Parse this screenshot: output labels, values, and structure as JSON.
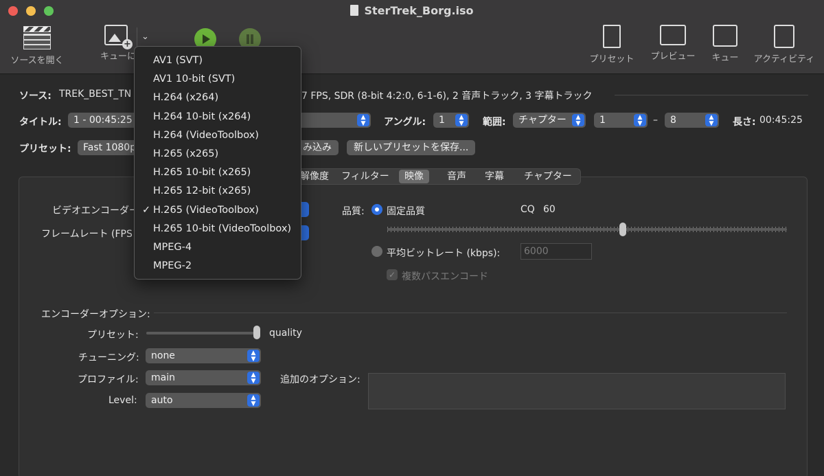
{
  "window": {
    "title": "SterTrek_Borg.iso"
  },
  "toolbar": {
    "open_source": "ソースを開く",
    "add_queue": "キューに",
    "presets": "プリセット",
    "preview": "プレビュー",
    "queue": "キュー",
    "activity": "アクティビティ"
  },
  "source": {
    "label": "ソース:",
    "name": "TREK_BEST_TN",
    "info": "7 FPS, SDR (8-bit 4:2:0, 6-1-6), 2 音声トラック, 3 字幕トラック"
  },
  "title_row": {
    "label": "タイトル:",
    "value": "1 - 00:45:25",
    "angle_label": "アングル:",
    "angle": "1",
    "range_label": "範囲:",
    "range_type": "チャプター",
    "range_from": "1",
    "range_dash": "–",
    "range_to": "8",
    "length_label": "長さ:",
    "length": "00:45:25"
  },
  "preset_row": {
    "label": "プリセット:",
    "value": "Fast 1080p",
    "reload": "み込み",
    "save_new": "新しいプリセットを保存..."
  },
  "tabs": [
    "解像度",
    "フィルター",
    "映像",
    "音声",
    "字幕",
    "チャプター"
  ],
  "selected_tab": "映像",
  "video": {
    "encoder_label": "ビデオエンコーダー",
    "framerate_label": "フレームレート (FPS",
    "quality_label": "品質:",
    "constant_quality": "固定品質",
    "cq_label": "CQ",
    "cq_value": "60",
    "cq_fraction": 0.59,
    "avg_bitrate_label": "平均ビットレート (kbps):",
    "avg_bitrate_value": "6000",
    "multipass": "複数パスエンコード"
  },
  "encoder_options": {
    "title": "エンコーダーオプション:",
    "preset_label": "プリセット:",
    "preset_value": "quality",
    "preset_fraction": 1.0,
    "tune_label": "チューニング:",
    "tune": "none",
    "profile_label": "プロファイル:",
    "profile": "main",
    "level_label": "Level:",
    "level": "auto",
    "additional_label": "追加のオプション:"
  },
  "encoder_menu": {
    "items": [
      "AV1 (SVT)",
      "AV1 10-bit (SVT)",
      "H.264 (x264)",
      "H.264 10-bit (x264)",
      "H.264 (VideoToolbox)",
      "H.265 (x265)",
      "H.265 10-bit (x265)",
      "H.265 12-bit (x265)",
      "H.265 (VideoToolbox)",
      "H.265 10-bit (VideoToolbox)",
      "MPEG-4",
      "MPEG-2"
    ],
    "checkmark": "✓",
    "selected": "H.265 (VideoToolbox)"
  },
  "colors": {
    "accent": "#2f6fe0",
    "play": "#6bb33a"
  }
}
